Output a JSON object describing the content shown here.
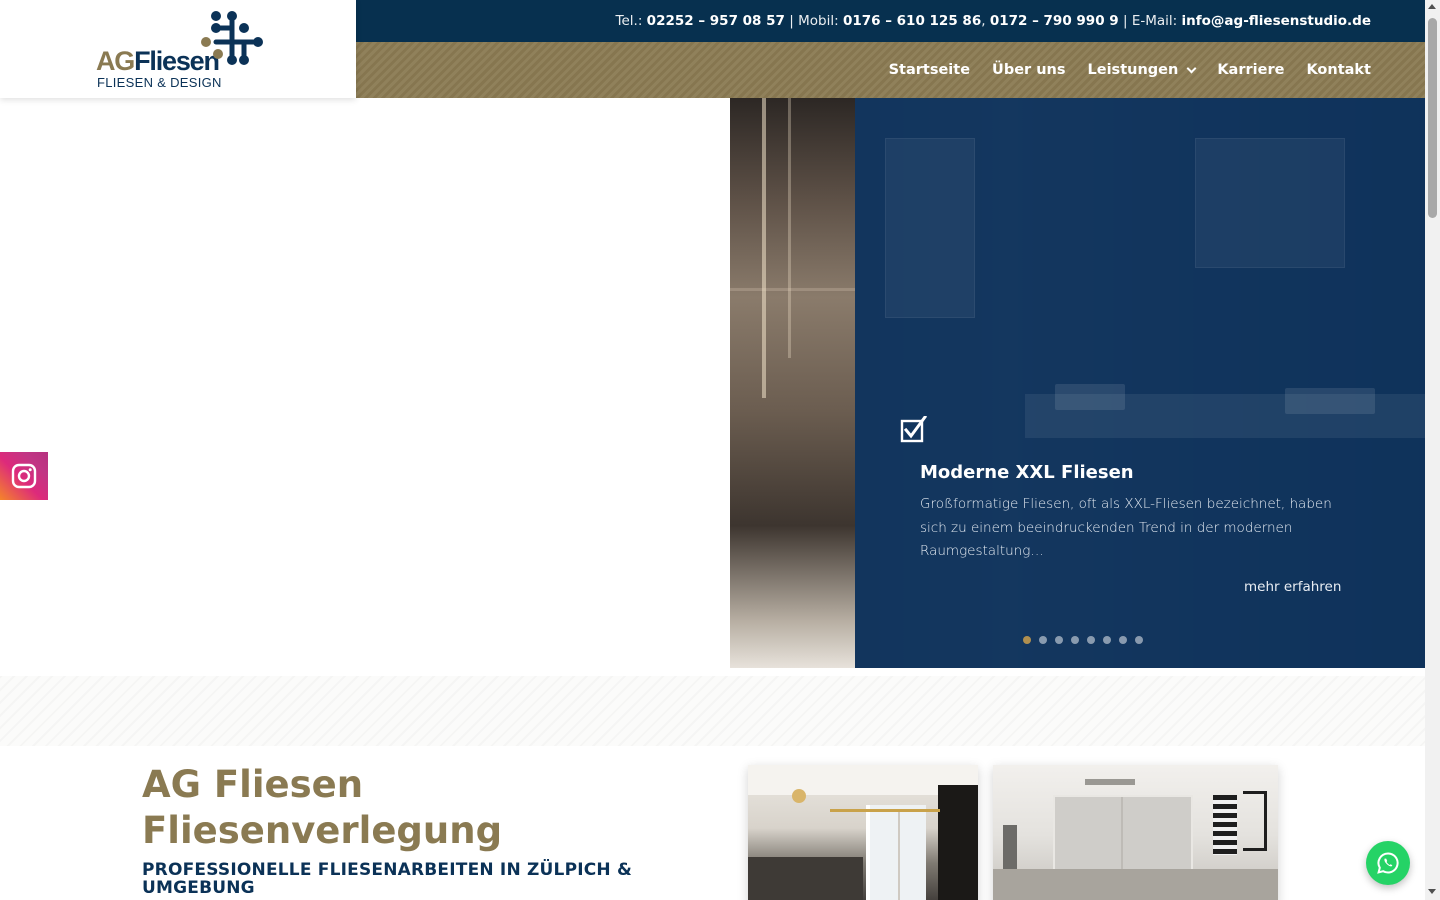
{
  "logo": {
    "brand_part1": "AG",
    "brand_part2": "Fliesen",
    "tagline": "FLIESEN & DESIGN",
    "colors": {
      "gold": "#8a7a52",
      "navy": "#0b3257"
    }
  },
  "topbar": {
    "tel_label": "Tel.:",
    "tel": "02252 – 957 08 57",
    "sep1": "|",
    "mobil_label": "Mobil:",
    "mobil1": "0176 – 610 125 86",
    "comma": ",",
    "mobil2": "0172 – 790 990 9",
    "sep2": "|",
    "email_label": "E-Mail:",
    "email": "info@ag-fliesenstudio.de"
  },
  "nav": {
    "items": [
      {
        "label": "Startseite"
      },
      {
        "label": "Über uns"
      },
      {
        "label": "Leistungen",
        "has_dropdown": true
      },
      {
        "label": "Karriere"
      },
      {
        "label": "Kontakt"
      }
    ]
  },
  "slider": {
    "icon": "checkbox-check-icon",
    "title": "Moderne XXL Fliesen",
    "text": "Großformatige Fliesen, oft als XXL-Fliesen bezeichnet, haben sich zu einem beeindruckenden Trend in der modernen Raumgestaltung…",
    "more_label": "mehr erfahren",
    "slide_count": 8,
    "active_index": 0,
    "colors": {
      "overlay": "#0d3460",
      "active_dot": "#b08f4f"
    }
  },
  "social": {
    "instagram_icon": "instagram-icon"
  },
  "intro": {
    "title_line1": "AG Fliesen",
    "title_line2": "Fliesenverlegung",
    "subtitle": "PROFESSIONELLE FLIESENARBEITEN IN ZÜLPICH & UMGEBUNG"
  },
  "gallery": {
    "images": [
      "kitchen-photo",
      "bathroom-photo"
    ]
  },
  "whatsapp": {
    "icon": "whatsapp-icon",
    "color": "#25d366"
  }
}
